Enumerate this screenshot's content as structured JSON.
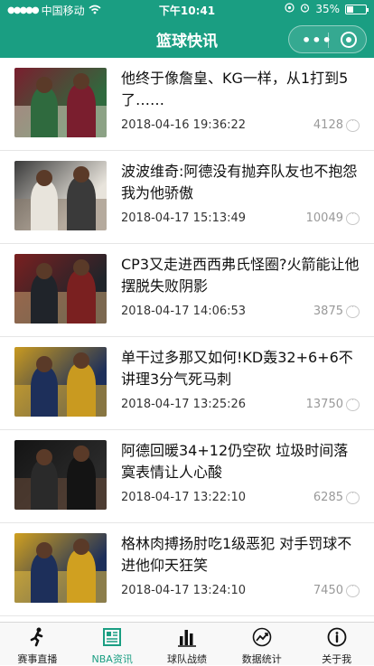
{
  "status_bar": {
    "carrier": "中国移动",
    "time": "下午10:41",
    "battery_percent": "35%",
    "battery_level": 0.35
  },
  "nav": {
    "title": "篮球快讯",
    "more_glyph": "•••"
  },
  "news": [
    {
      "title": "他终于像詹皇、KG一样，从1打到5了……",
      "date": "2018-04-16 19:36:22",
      "views": "4128",
      "thumb_colors": [
        "#7a1e2e",
        "#2f6a3e",
        "#d8d0c0"
      ]
    },
    {
      "title": "波波维奇:阿德没有抛弃队友也不抱怨我为他骄傲",
      "date": "2018-04-17 15:13:49",
      "views": "10049",
      "thumb_colors": [
        "#3a3a3a",
        "#e8e4dc",
        "#8a7a6a"
      ]
    },
    {
      "title": "CP3又走进西西弗氏怪圈?火箭能让他摆脱失败阴影",
      "date": "2018-04-17 14:06:53",
      "views": "3875",
      "thumb_colors": [
        "#7a2020",
        "#20242a",
        "#c8a070"
      ]
    },
    {
      "title": "单干过多那又如何!KD轰32+6+6不讲理3分气死马刺",
      "date": "2018-04-17 13:25:26",
      "views": "13750",
      "thumb_colors": [
        "#c99a20",
        "#1d2f5a",
        "#e0b030"
      ]
    },
    {
      "title": "阿德回暖34+12仍空砍 垃圾时间落寞表情让人心酸",
      "date": "2018-04-17 13:22:10",
      "views": "6285",
      "thumb_colors": [
        "#141414",
        "#2a2a2a",
        "#6a4a38"
      ]
    },
    {
      "title": "格林肉搏扬肘吃1级恶犯 对手罚球不进他仰天狂笑",
      "date": "2018-04-17 13:24:10",
      "views": "7450",
      "thumb_colors": [
        "#d0a020",
        "#1d2f5a",
        "#e8c040"
      ]
    }
  ],
  "tabs": [
    {
      "label": "赛事直播",
      "icon": "running-player-icon",
      "active": false
    },
    {
      "label": "NBA资讯",
      "icon": "news-list-icon",
      "active": true
    },
    {
      "label": "球队战绩",
      "icon": "bar-chart-icon",
      "active": false
    },
    {
      "label": "数据统计",
      "icon": "trend-circle-icon",
      "active": false
    },
    {
      "label": "关于我",
      "icon": "info-circle-icon",
      "active": false
    }
  ],
  "colors": {
    "brand": "#1a9e82",
    "tab_active": "#1a9e82"
  }
}
